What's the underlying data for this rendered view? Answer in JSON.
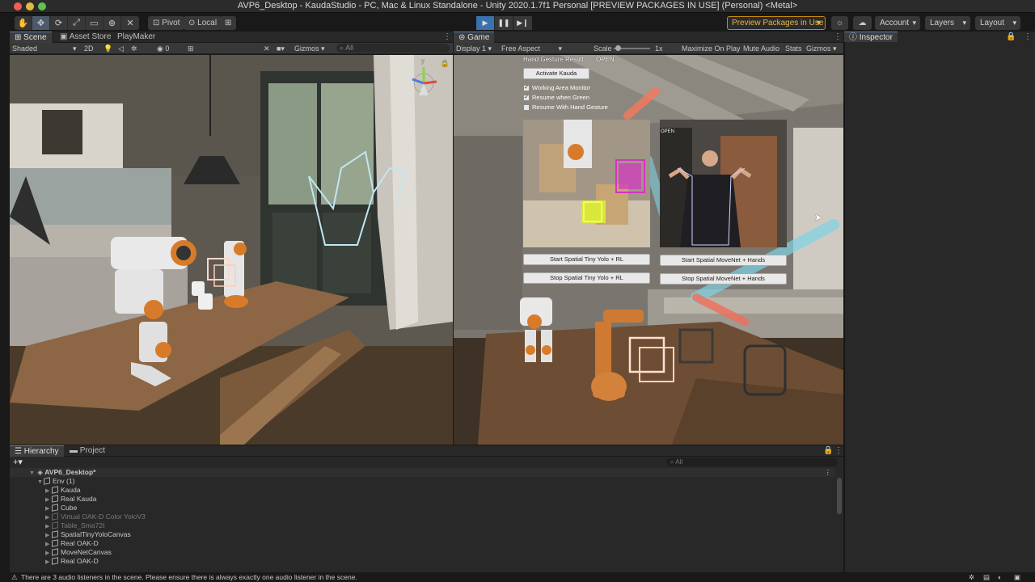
{
  "window": {
    "title": "AVP6_Desktop - KaudaStudio - PC, Mac & Linux Standalone - Unity 2020.1.7f1 Personal [PREVIEW PACKAGES IN USE] (Personal) <Metal>"
  },
  "toolbar": {
    "pivot_label": "Pivot",
    "local_label": "Local",
    "preview_packages_label": "Preview Packages in Use",
    "account_label": "Account",
    "layers_label": "Layers",
    "layout_label": "Layout"
  },
  "scene_panel": {
    "tabs": [
      "Scene",
      "Asset Store",
      "PlayMaker"
    ],
    "shading_mode": "Shaded",
    "mode_2d": "2D",
    "gizmos_label": "Gizmos",
    "search_placeholder": "All",
    "hidden_count": "0",
    "axis_y_label": "y"
  },
  "game_panel": {
    "tab": "Game",
    "display": "Display 1",
    "aspect": "Free Aspect",
    "scale_label": "Scale",
    "scale_value": "1x",
    "maximize_label": "Maximize On Play",
    "mute_label": "Mute Audio",
    "stats_label": "Stats",
    "gizmos_label": "Gizmos",
    "hand_gesture_label": "Hand Gesture Result:",
    "hand_gesture_value": "OPEN",
    "activate_button": "Activate Kauda",
    "checkboxes": [
      {
        "label": "Working Area Monitor",
        "checked": true
      },
      {
        "label": "Resume when Green",
        "checked": true
      },
      {
        "label": "Resume With Hand Gesture",
        "checked": false
      }
    ],
    "right_feed_overlay": "OPEN",
    "buttons": {
      "start_yolo": "Start Spatial Tiny Yolo + RL",
      "stop_yolo": "Stop Spatial Tiny Yolo + RL",
      "start_movenet": "Start Spatial MoveNet + Hands",
      "stop_movenet": "Stop Spatial MoveNet + Hands"
    }
  },
  "inspector": {
    "tab": "Inspector"
  },
  "hierarchy": {
    "tabs": [
      "Hierarchy",
      "Project"
    ],
    "search_placeholder": "All",
    "scene_name": "AVP6_Desktop*",
    "items": [
      {
        "label": "Env (1)",
        "depth": 1,
        "dim": false
      },
      {
        "label": "Kauda",
        "depth": 2,
        "dim": false
      },
      {
        "label": "Real Kauda",
        "depth": 2,
        "dim": false
      },
      {
        "label": "Cube",
        "depth": 2,
        "dim": false
      },
      {
        "label": "Virtual OAK-D Color YoloV3",
        "depth": 2,
        "dim": true
      },
      {
        "label": "Table_Sma72t",
        "depth": 2,
        "dim": true
      },
      {
        "label": "SpatialTinyYoloCanvas",
        "depth": 2,
        "dim": false
      },
      {
        "label": "Real OAK-D",
        "depth": 2,
        "dim": false
      },
      {
        "label": "MoveNetCanvas",
        "depth": 2,
        "dim": false
      },
      {
        "label": "Real OAK-D",
        "depth": 2,
        "dim": false
      }
    ]
  },
  "status_bar": {
    "message": "There are 3 audio listeners in the scene. Please ensure there is always exactly one audio listener in the scene."
  }
}
